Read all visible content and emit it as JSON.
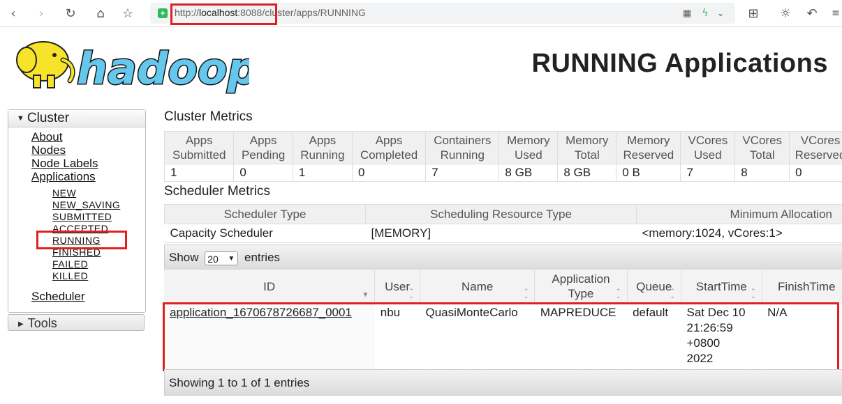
{
  "browser": {
    "url_prefix": "http://",
    "url_host": "localhost",
    "url_port": ":8088",
    "url_path": "/cluster/apps/RUNNING"
  },
  "header": {
    "logo_text": "hadoop",
    "title": "RUNNING Applications"
  },
  "sidebar": {
    "cluster_label": "Cluster",
    "links": [
      "About",
      "Nodes",
      "Node Labels",
      "Applications"
    ],
    "app_states": [
      "NEW",
      "NEW_SAVING",
      "SUBMITTED",
      "ACCEPTED",
      "RUNNING",
      "FINISHED",
      "FAILED",
      "KILLED"
    ],
    "scheduler_label": "Scheduler",
    "tools_label": "Tools"
  },
  "cluster_metrics": {
    "title": "Cluster Metrics",
    "headers": [
      [
        "Apps",
        "Submitted"
      ],
      [
        "Apps",
        "Pending"
      ],
      [
        "Apps",
        "Running"
      ],
      [
        "Apps",
        "Completed"
      ],
      [
        "Containers",
        "Running"
      ],
      [
        "Memory",
        "Used"
      ],
      [
        "Memory",
        "Total"
      ],
      [
        "Memory",
        "Reserved"
      ],
      [
        "VCores",
        "Used"
      ],
      [
        "VCores",
        "Total"
      ],
      [
        "VCores",
        "Reserved"
      ]
    ],
    "values": [
      "1",
      "0",
      "1",
      "0",
      "7",
      "8 GB",
      "8 GB",
      "0 B",
      "7",
      "8",
      "0"
    ]
  },
  "scheduler_metrics": {
    "title": "Scheduler Metrics",
    "headers": [
      "Scheduler Type",
      "Scheduling Resource Type",
      "Minimum Allocation"
    ],
    "values": [
      "Capacity Scheduler",
      "[MEMORY]",
      "<memory:1024, vCores:1>"
    ]
  },
  "apps_table": {
    "show_label": "Show",
    "entries_value": "20",
    "entries_label": "entries",
    "headers": [
      [
        "ID"
      ],
      [
        "User"
      ],
      [
        "Name"
      ],
      [
        "Application",
        "Type"
      ],
      [
        "Queue"
      ],
      [
        "StartTime"
      ],
      [
        "FinishTime"
      ]
    ],
    "rows": [
      {
        "id": "application_1670678726687_0001",
        "user": "nbu",
        "name": "QuasiMonteCarlo",
        "type": "MAPREDUCE",
        "queue": "default",
        "start": [
          "Sat Dec 10",
          "21:26:59",
          "+0800",
          "2022"
        ],
        "finish": "N/A"
      }
    ],
    "footer": "Showing 1 to 1 of 1 entries"
  }
}
